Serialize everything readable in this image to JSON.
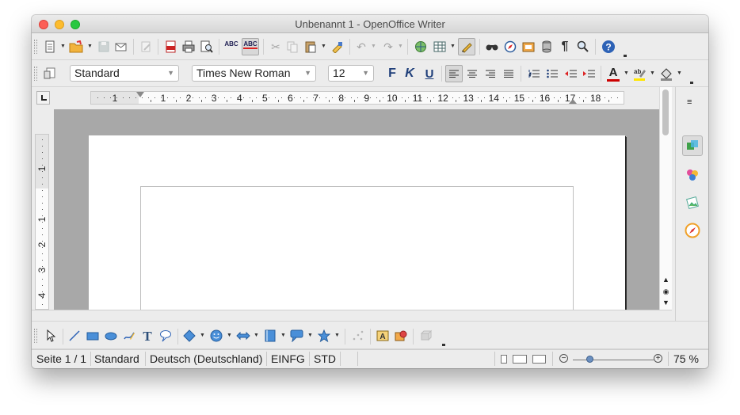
{
  "window": {
    "title": "Unbenannt 1 - OpenOffice Writer"
  },
  "standard_toolbar": {
    "icons": [
      "new-document-icon",
      "open-icon",
      "save-icon",
      "email-icon",
      "edit-file-icon",
      "export-pdf-icon",
      "print-icon",
      "print-preview-icon",
      "spellcheck-icon",
      "autospellcheck-icon",
      "cut-icon",
      "copy-icon",
      "paste-icon",
      "clone-formatting-icon",
      "undo-icon",
      "redo-icon",
      "hyperlink-icon",
      "table-icon",
      "show-draw-functions-icon",
      "find-replace-icon",
      "navigator-icon",
      "gallery-icon",
      "data-sources-icon",
      "formatting-marks-icon",
      "zoom-icon",
      "help-icon"
    ]
  },
  "formatting_toolbar": {
    "paragraph_style": "Standard",
    "font_name": "Times New Roman",
    "font_size": "12",
    "bold_label": "F",
    "italic_label": "K",
    "underline_label": "U",
    "font_color": "#cc0000",
    "highlight_color": "#ffe600"
  },
  "ruler": {
    "horizontal_labels": [
      "1",
      "1",
      "2",
      "3",
      "4",
      "5",
      "6",
      "7",
      "8",
      "9",
      "10",
      "11",
      "12",
      "13",
      "14",
      "15",
      "16",
      "17",
      "18"
    ],
    "vertical_labels": [
      "1",
      "1",
      "2",
      "3",
      "4"
    ]
  },
  "drawing_toolbar": {
    "icons": [
      "select-icon",
      "line-icon",
      "rectangle-icon",
      "ellipse-icon",
      "freeform-icon",
      "text-icon",
      "callout-icon",
      "basic-shapes-icon",
      "symbol-shapes-icon",
      "block-arrows-icon",
      "flowchart-icon",
      "callouts-icon",
      "stars-icon",
      "points-icon",
      "fontwork-gallery-icon",
      "from-file-icon",
      "extrusion-icon"
    ]
  },
  "sidebar": {
    "icons": [
      "properties-icon",
      "styles-icon",
      "gallery-icon",
      "navigator-icon"
    ]
  },
  "statusbar": {
    "page": "Seite 1 / 1",
    "style": "Standard",
    "language": "Deutsch (Deutschland)",
    "insert_mode": "EINFG",
    "selection_mode": "STD",
    "zoom": "75 %",
    "zoom_level": 0.75
  }
}
